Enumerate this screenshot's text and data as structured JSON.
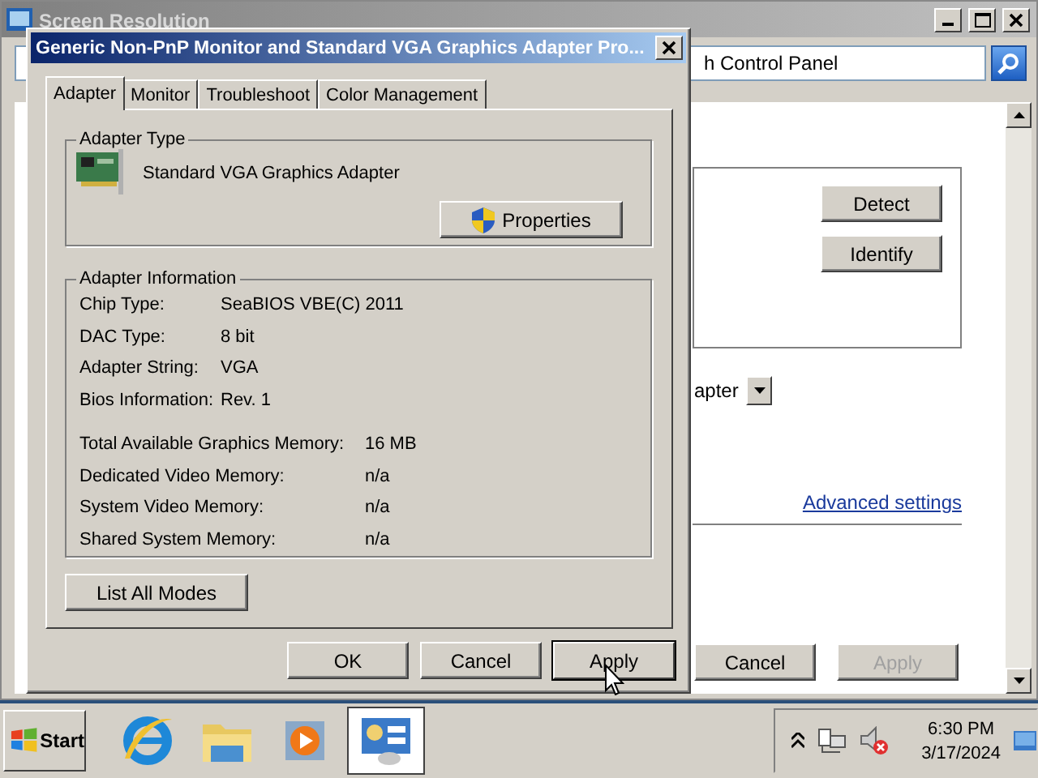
{
  "background_window": {
    "title": "Screen Resolution",
    "address": "h Control Panel",
    "monitor_buttons": [
      "Detect",
      "Identify"
    ],
    "display_value": "apter",
    "advanced_link": "Advanced settings",
    "buttons": [
      {
        "label": "Cancel",
        "disabled": false
      },
      {
        "label": "Apply",
        "disabled": true
      }
    ]
  },
  "dialog": {
    "title": "Generic Non-PnP Monitor and Standard VGA Graphics Adapter Pro...",
    "tabs": [
      {
        "label": "Adapter",
        "selected": true
      },
      {
        "label": "Monitor",
        "selected": false
      },
      {
        "label": "Troubleshoot",
        "selected": false
      },
      {
        "label": "Color Management",
        "selected": false
      }
    ],
    "adapter_type": {
      "legend": "Adapter Type",
      "name": "Standard VGA Graphics Adapter",
      "button": "Properties"
    },
    "adapter_information": {
      "legend": "Adapter Information",
      "rows": [
        {
          "label": "Chip Type:",
          "value": "SeaBIOS VBE(C) 2011"
        },
        {
          "label": "DAC Type:",
          "value": "8 bit"
        },
        {
          "label": "Adapter String:",
          "value": "VGA"
        },
        {
          "label": "Bios Information:",
          "value": "Rev. 1"
        }
      ],
      "memory_rows": [
        {
          "label": "Total Available Graphics Memory:",
          "value": "16 MB"
        },
        {
          "label": "Dedicated Video Memory:",
          "value": "n/a"
        },
        {
          "label": "System Video Memory:",
          "value": "n/a"
        },
        {
          "label": "Shared System Memory:",
          "value": "n/a"
        }
      ]
    },
    "list_modes_button": "List All Modes",
    "buttons": [
      {
        "label": "OK",
        "focused": false
      },
      {
        "label": "Cancel",
        "focused": false
      },
      {
        "label": "Apply",
        "focused": true
      }
    ]
  },
  "taskbar": {
    "start": "Start",
    "apps": [
      {
        "kind": "browser",
        "selected": false
      },
      {
        "kind": "folder",
        "selected": false
      },
      {
        "kind": "media",
        "selected": false
      },
      {
        "kind": "control",
        "selected": true
      }
    ],
    "clock": {
      "time": "6:30 PM",
      "date": "3/17/2024"
    }
  }
}
